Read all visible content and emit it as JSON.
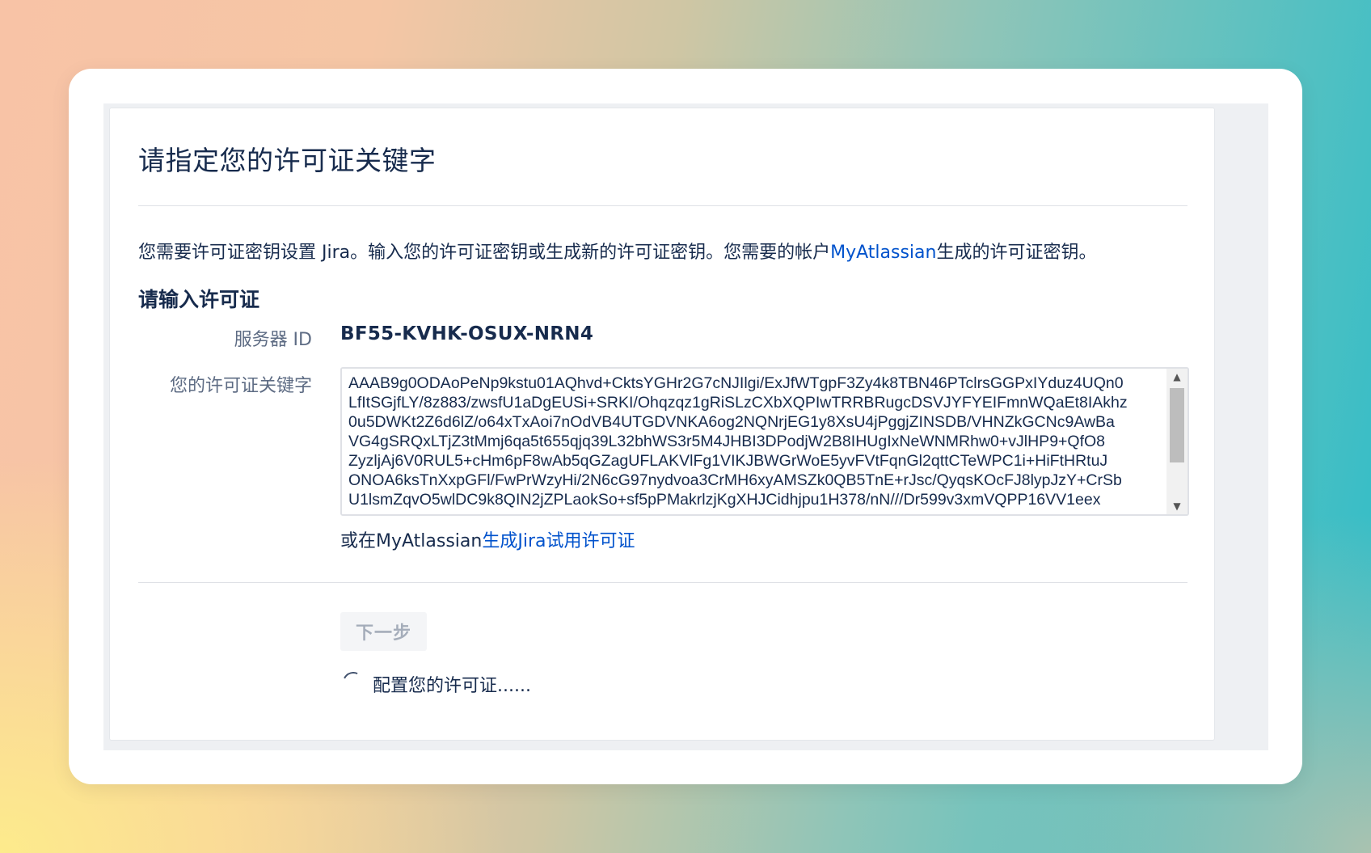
{
  "page": {
    "title": "请指定您的许可证关键字",
    "intro": {
      "before": "您需要许可证密钥设置 Jira。输入您的许可证密钥或生成新的许可证密钥。您需要的帐户",
      "link": "MyAtlassian",
      "after": "生成的许可证密钥。"
    },
    "section_title": "请输入许可证"
  },
  "form": {
    "server_label": "服务器 ID",
    "server_id": "BF55-KVHK-OSUX-NRN4",
    "key_label": "您的许可证关键字",
    "key_value": "AAAB9g0ODAoPeNp9kstu01AQhvd+CktsYGHr2G7cNJIlgi/ExJfWTgpF3Zy4k8TBN46PTclrsGGPxIYduz4UQn0\nLfItSGjfLY/8z883/zwsfU1aDgEUSi+SRKI/Ohqzqz1gRiSLzCXbXQPIwTRRBRugcDSVJYFYEIFmnWQaEt8IAkhz\n0u5DWKt2Z6d6lZ/o64xTxAoi7nOdVB4UTGDVNKA6og2NQNrjEG1y8XsU4jPggjZINSDB/VHNZkGCNc9AwBa\nVG4gSRQxLTjZ3tMmj6qa5t655qjq39L32bhWS3r5M4JHBI3DPodjW2B8IHUgIxNeWNMRhw0+vJlHP9+QfO8\nZyzljAj6V0RUL5+cHm6pF8wAb5qGZagUFLAKVlFg1VIKJBWGrWoE5yvFVtFqnGl2qttCTeWPC1i+HiFtHRtuJ\nONOA6ksTnXxpGFl/FwPrWzyHi/2N6cG97nydvoa3CrMH6xyAMSZk0QB5TnE+rJsc/QyqsKOcFJ8lypJzY+CrSb\nU1lsmZqvO5wlDC9k8QIN2jZPLaokSo+sf5pPMakrlzjKgXHJCidhjpu1H378/nN///Dr599v3xmVQPP16VV1eex",
    "alt_prefix": "或在MyAtlassian",
    "alt_link": "生成Jira试用许可证",
    "next_label": "下一步",
    "status_text": "配置您的许可证......"
  }
}
